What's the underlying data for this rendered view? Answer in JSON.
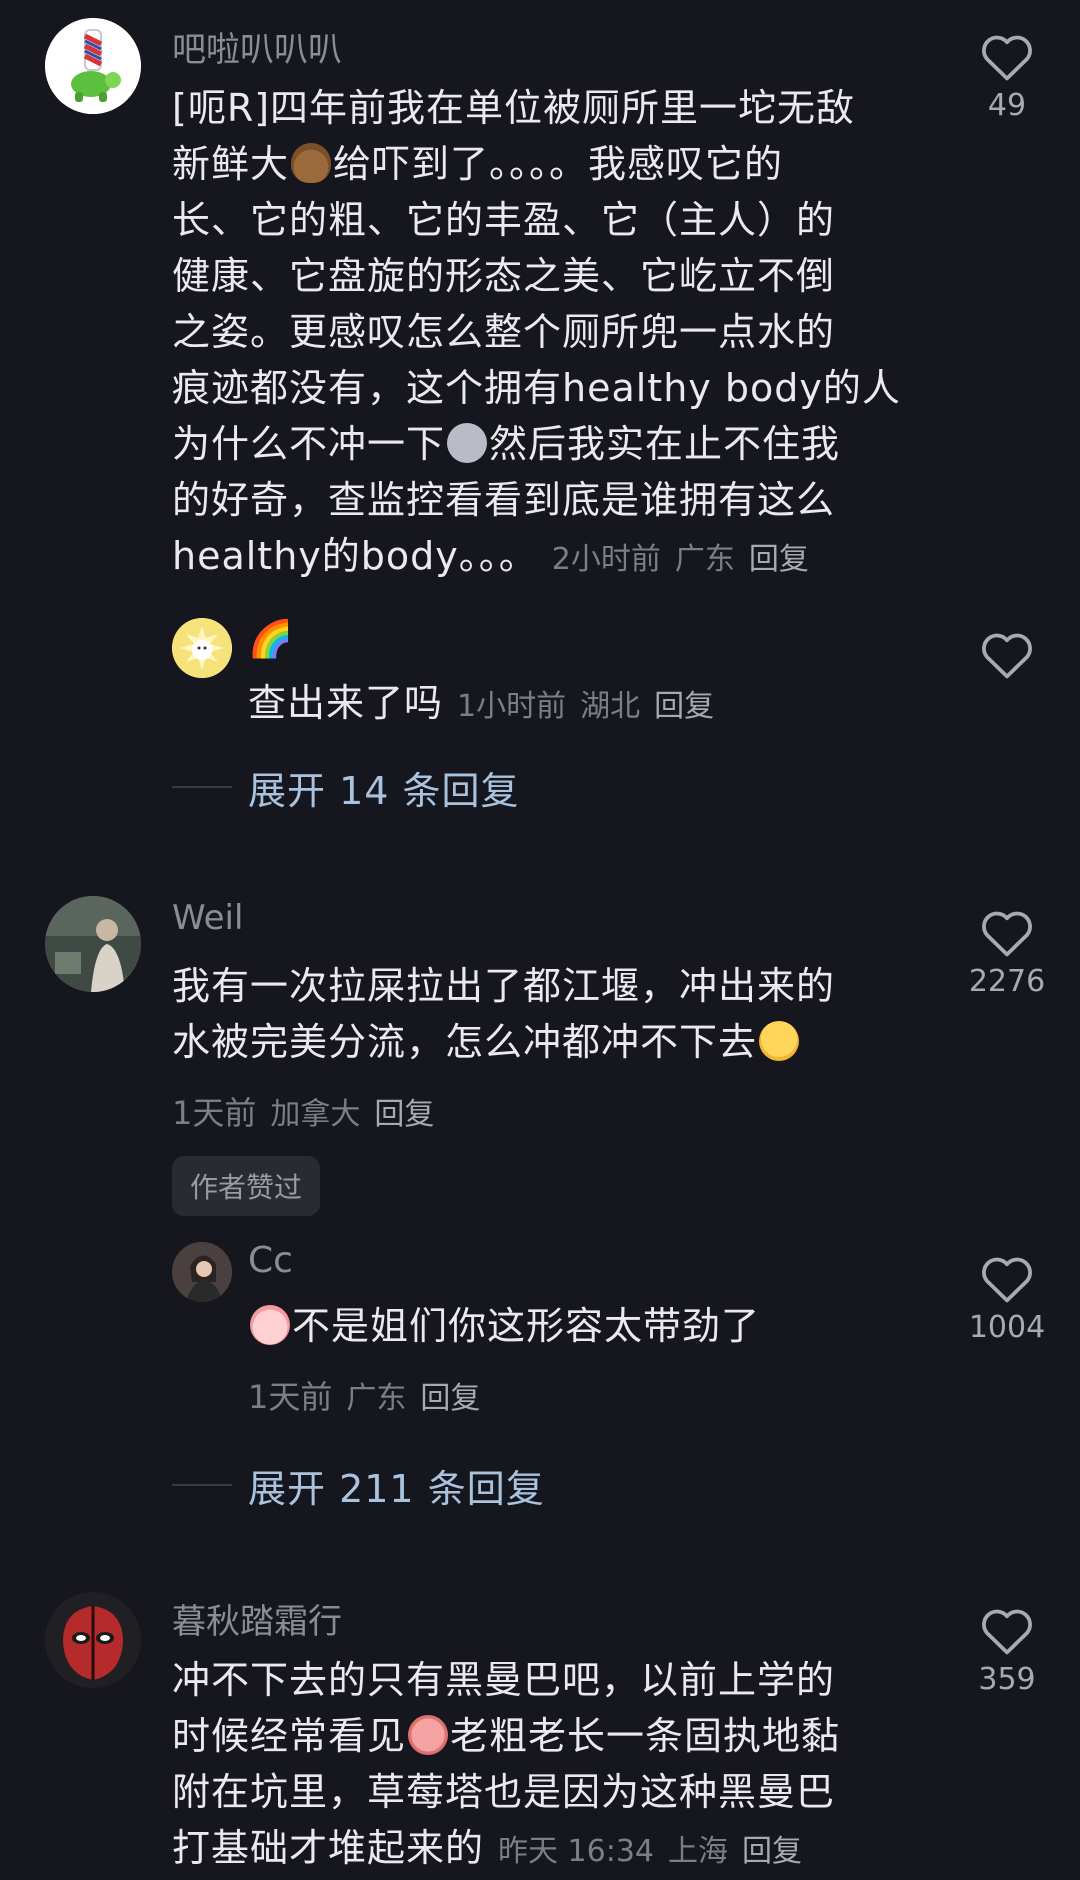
{
  "comments": [
    {
      "username": "吧啦叭叭叭",
      "text_1": "[呃R]四年前我在单位被厕所里一坨无敌",
      "text_2a": "新鲜大",
      "text_2b": "给吓到了。。。。我感叹它的",
      "text_3": "长、它的粗、它的丰盈、它（主人）的",
      "text_4": "健康、它盘旋的形态之美、它屹立不倒",
      "text_5": "之姿。更感叹怎么整个厕所兜一点水的",
      "text_6": "痕迹都没有，这个拥有healthy body的人",
      "text_7a": "为什么不冲一下",
      "text_7b": "然后我实在止不住我",
      "text_8": "的好奇，查监控看看到底是谁拥有这么",
      "text_9": "healthy的body。。。",
      "time": "2小时前",
      "location": "广东",
      "reply": "回复",
      "likes": "49",
      "sub_reply": {
        "username": "🌈",
        "text": "查出来了吗",
        "time": "1小时前",
        "location": "湖北",
        "reply": "回复"
      },
      "expand": "展开 14 条回复"
    },
    {
      "username": "Weil",
      "text_1": "我有一次拉屎拉出了都江堰，冲出来的",
      "text_2": "水被完美分流，怎么冲都冲不下去",
      "time": "1天前",
      "location": "加拿大",
      "reply": "回复",
      "likes": "2276",
      "badge": "作者赞过",
      "sub_reply": {
        "username": "Cc",
        "text": "不是姐们你这形容太带劲了",
        "time": "1天前",
        "location": "广东",
        "reply": "回复",
        "likes": "1004"
      },
      "expand": "展开 211 条回复"
    },
    {
      "username": "暮秋踏霜行",
      "text_1": "冲不下去的只有黑曼巴吧，以前上学的",
      "text_2a": "时候经常看见",
      "text_2b": "老粗老长一条固执地黏",
      "text_3": "附在坑里，草莓塔也是因为这种黑曼巴",
      "text_4": "打基础才堆起来的",
      "time": "昨天 16:34",
      "location": "上海",
      "reply": "回复",
      "likes": "359"
    }
  ],
  "colors": {
    "background": "#16161e",
    "text": "#e9e9ee",
    "meta": "#7d7d88",
    "link": "#a9c3de"
  },
  "icons": [
    "heart-outline-icon",
    "poop-emoji",
    "ghost-emoji",
    "cheeky-face-emoji",
    "peach-face-emoji",
    "crying-face-emoji"
  ]
}
